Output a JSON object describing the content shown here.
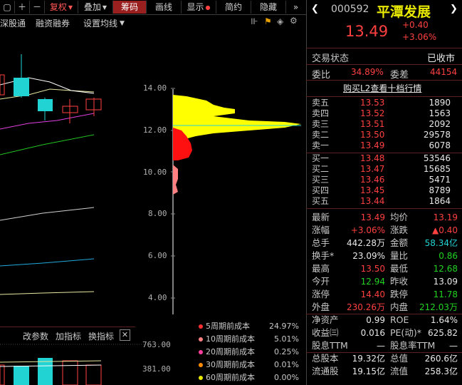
{
  "toolbar": {
    "items": [
      "复权",
      "叠加",
      "筹码",
      "画线",
      "显示",
      "简约",
      "隐藏"
    ],
    "more": "»"
  },
  "subbar": {
    "left_text": "深股通",
    "margin": "融资融券",
    "ma_setting": "设置均线"
  },
  "stock": {
    "code": "000592",
    "name": "平潭发展",
    "price": "13.49",
    "change": "+0.40",
    "change_pct": "+3.06%"
  },
  "trade_status": {
    "label": "交易状态",
    "value": "已收市"
  },
  "weibi": {
    "label": "委比",
    "value": "34.89%",
    "diff_label": "委差",
    "diff_value": "44154"
  },
  "l2_link": "购买L2查看十档行情",
  "sell": [
    {
      "label": "卖五",
      "price": "13.53",
      "vol": "1890"
    },
    {
      "label": "卖四",
      "price": "13.52",
      "vol": "1563"
    },
    {
      "label": "卖三",
      "price": "13.51",
      "vol": "2092"
    },
    {
      "label": "卖二",
      "price": "13.50",
      "vol": "29578"
    },
    {
      "label": "卖一",
      "price": "13.49",
      "vol": "6078"
    }
  ],
  "buy": [
    {
      "label": "买一",
      "price": "13.48",
      "vol": "53546"
    },
    {
      "label": "买二",
      "price": "13.47",
      "vol": "15685"
    },
    {
      "label": "买三",
      "price": "13.46",
      "vol": "5471"
    },
    {
      "label": "买四",
      "price": "13.45",
      "vol": "8789"
    },
    {
      "label": "买五",
      "price": "13.44",
      "vol": "1864"
    }
  ],
  "stats": [
    {
      "l1": "最新",
      "v1": "13.49",
      "c1": "red",
      "l2": "均价",
      "v2": "13.19",
      "c2": "red"
    },
    {
      "l1": "涨幅",
      "v1": "+3.06%",
      "c1": "red",
      "l2": "涨跌",
      "v2": "▲0.40",
      "c2": "red"
    },
    {
      "l1": "总手",
      "v1": "442.28万",
      "c1": "white",
      "l2": "金额",
      "v2": "58.34亿",
      "c2": "cyan"
    },
    {
      "l1": "换手*",
      "v1": "23.09%",
      "c1": "white",
      "l2": "量比",
      "v2": "0.86",
      "c2": "green"
    },
    {
      "l1": "最高",
      "v1": "13.50",
      "c1": "red",
      "l2": "最低",
      "v2": "12.68",
      "c2": "green"
    },
    {
      "l1": "今开",
      "v1": "12.94",
      "c1": "green",
      "l2": "昨收",
      "v2": "13.09",
      "c2": "white"
    },
    {
      "l1": "涨停",
      "v1": "14.40",
      "c1": "red",
      "l2": "跌停",
      "v2": "11.78",
      "c2": "green"
    },
    {
      "l1": "外盘",
      "v1": "230.26万",
      "c1": "red",
      "l2": "内盘",
      "v2": "212.03万",
      "c2": "green"
    },
    {
      "l1": "净资产",
      "v1": "0.99",
      "c1": "white",
      "l2": "ROE",
      "v2": "1.64%",
      "c2": "white"
    },
    {
      "l1": "收益㈢",
      "v1": "0.016",
      "c1": "white",
      "l2": "PE(动)*",
      "v2": "625.82",
      "c2": "white"
    },
    {
      "l1": "股息TTM",
      "v1": "—",
      "c1": "white",
      "l2": "股息率TTM",
      "v2": "—",
      "c2": "white"
    },
    {
      "l1": "总股本",
      "v1": "19.32亿",
      "c1": "white",
      "l2": "总值",
      "v2": "260.6亿",
      "c2": "white"
    },
    {
      "l1": "流通股",
      "v1": "19.15亿",
      "c1": "white",
      "l2": "流值",
      "v2": "258.3亿",
      "c2": "white"
    }
  ],
  "price_axis": [
    "14.00",
    "12.00",
    "10.00",
    "8.00",
    "6.00",
    "4.00"
  ],
  "volume_axis": [
    "763.00",
    "381.00"
  ],
  "indicator_bar": {
    "change": "改参数",
    "add": "加指标",
    "switch": "换指标",
    "close": "✕"
  },
  "chip_legend": [
    {
      "name": "5周期前成本",
      "pct": "24.97%",
      "color": "#ff3030"
    },
    {
      "name": "10周期前成本",
      "pct": "5.01%",
      "color": "#ff8080"
    },
    {
      "name": "20周期前成本",
      "pct": "0.25%",
      "color": "#ff40a0"
    },
    {
      "name": "30周期前成本",
      "pct": "0.01%",
      "color": "#ff8c00"
    },
    {
      "name": "60周期前成本",
      "pct": "0.00%",
      "color": "#e8e800"
    }
  ],
  "colors": {
    "up": "#ff4040",
    "down": "#21d321",
    "cyan": "#22d3d3",
    "yellow": "#e8e800",
    "accent_bar": "#9a1f1f"
  }
}
